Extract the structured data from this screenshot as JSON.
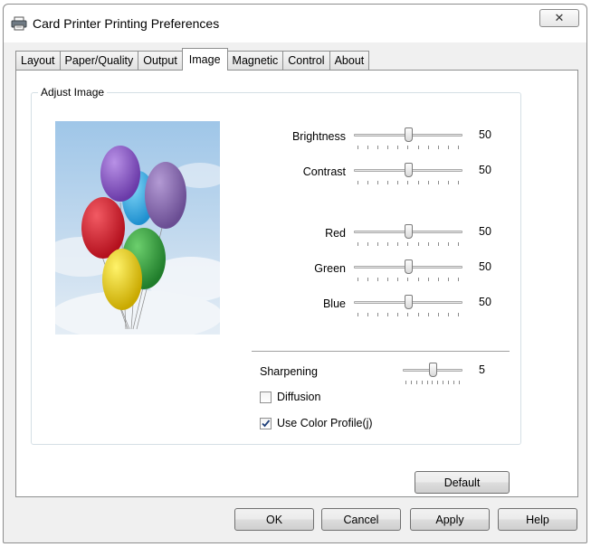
{
  "window": {
    "title": "Card Printer Printing Preferences",
    "close_label": "✕"
  },
  "tabs": [
    {
      "label": "Layout",
      "active": false
    },
    {
      "label": "Paper/Quality",
      "active": false
    },
    {
      "label": "Output",
      "active": false
    },
    {
      "label": "Image",
      "active": true
    },
    {
      "label": "Magnetic",
      "active": false
    },
    {
      "label": "Control",
      "active": false
    },
    {
      "label": "About",
      "active": false
    }
  ],
  "adjust_image": {
    "group_label": "Adjust Image",
    "sliders": {
      "brightness": {
        "label": "Brightness",
        "value": 50,
        "min": 0,
        "max": 100
      },
      "contrast": {
        "label": "Contrast",
        "value": 50,
        "min": 0,
        "max": 100
      },
      "red": {
        "label": "Red",
        "value": 50,
        "min": 0,
        "max": 100
      },
      "green": {
        "label": "Green",
        "value": 50,
        "min": 0,
        "max": 100
      },
      "blue": {
        "label": "Blue",
        "value": 50,
        "min": 0,
        "max": 100
      },
      "sharpening": {
        "label": "Sharpening",
        "value": 5,
        "min": 0,
        "max": 10
      }
    },
    "diffusion": {
      "label": "Diffusion",
      "checked": false
    },
    "use_color_profile": {
      "label": "Use Color Profile(j)",
      "checked": true
    },
    "default_button": "Default"
  },
  "footer": {
    "ok": "OK",
    "cancel": "Cancel",
    "apply": "Apply",
    "help": "Help"
  },
  "colors": {
    "dialog_bg": "#f0f0f0",
    "panel_bg": "#ffffff",
    "border": "#8e8f8f"
  }
}
